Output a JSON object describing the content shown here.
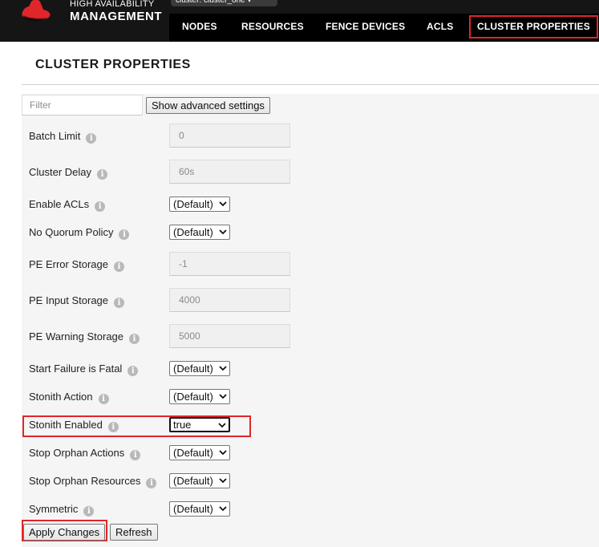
{
  "brand": {
    "line1": "HIGH AVAILABILITY",
    "line2": "MANAGEMENT"
  },
  "cluster_selector": {
    "label": "cluster: cluster_one ▾"
  },
  "nav": {
    "tabs": [
      {
        "label": "NODES",
        "active": false
      },
      {
        "label": "RESOURCES",
        "active": false
      },
      {
        "label": "FENCE DEVICES",
        "active": false
      },
      {
        "label": "ACLS",
        "active": false
      },
      {
        "label": "CLUSTER PROPERTIES",
        "active": true
      }
    ]
  },
  "page": {
    "title": "CLUSTER PROPERTIES"
  },
  "filter": {
    "placeholder": "Filter",
    "value": ""
  },
  "buttons": {
    "advanced": "Show advanced settings",
    "apply": "Apply Changes",
    "refresh": "Refresh"
  },
  "properties": [
    {
      "label": "Batch Limit",
      "type": "text",
      "value": "0"
    },
    {
      "label": "Cluster Delay",
      "type": "text",
      "value": "60s"
    },
    {
      "label": "Enable ACLs",
      "type": "select",
      "value": "(Default)"
    },
    {
      "label": "No Quorum Policy",
      "type": "select",
      "value": "(Default)"
    },
    {
      "label": "PE Error Storage",
      "type": "text",
      "value": "-1"
    },
    {
      "label": "PE Input Storage",
      "type": "text",
      "value": "4000"
    },
    {
      "label": "PE Warning Storage",
      "type": "text",
      "value": "5000"
    },
    {
      "label": "Start Failure is Fatal",
      "type": "select",
      "value": "(Default)"
    },
    {
      "label": "Stonith Action",
      "type": "select",
      "value": "(Default)"
    },
    {
      "label": "Stonith Enabled",
      "type": "select",
      "value": "true"
    },
    {
      "label": "Stop Orphan Actions",
      "type": "select",
      "value": "(Default)"
    },
    {
      "label": "Stop Orphan Resources",
      "type": "select",
      "value": "(Default)"
    },
    {
      "label": "Symmetric",
      "type": "select",
      "value": "(Default)"
    }
  ],
  "info_icon_glyph": "i",
  "colors": {
    "header_bg": "#151515",
    "nav_bg": "#000000",
    "accent_red": "#e0262b",
    "panel_bg": "#f5f5f5"
  }
}
